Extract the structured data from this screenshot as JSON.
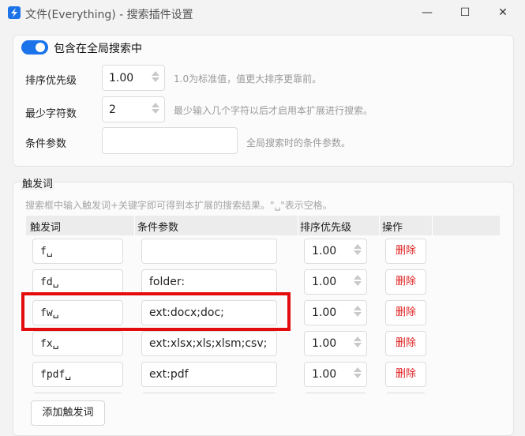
{
  "window": {
    "title": "文件(Everything) - 搜索插件设置",
    "minimize": "—",
    "maximize": "☐",
    "close": "✕",
    "app_icon": "app-logo-icon"
  },
  "settings": {
    "include_global_label": "包含在全局搜索中",
    "include_global_on": true,
    "priority": {
      "label": "排序优先级",
      "value": "1.00",
      "hint": "1.0为标准值，值更大排序更靠前。"
    },
    "min_chars": {
      "label": "最少字符数",
      "value": "2",
      "hint": "最少输入几个字符以后才启用本扩展进行搜索。"
    },
    "condition": {
      "label": "条件参数",
      "value": "",
      "hint": "全局搜索时的条件参数。"
    }
  },
  "triggers": {
    "section_title": "触发词",
    "hint": "搜索框中输入触发词+关键字即可得到本扩展的搜索结果。\"␣\"表示空格。",
    "columns": {
      "trigger": "触发词",
      "condition": "条件参数",
      "priority": "排序优先级",
      "actions": "操作"
    },
    "rows": [
      {
        "trigger": "f␣",
        "condition": "",
        "priority": "1.00",
        "delete_label": "删除"
      },
      {
        "trigger": "fd␣",
        "condition": "folder:",
        "priority": "1.00",
        "delete_label": "删除"
      },
      {
        "trigger": "fw␣",
        "condition": "ext:docx;doc;",
        "priority": "1.00",
        "delete_label": "删除"
      },
      {
        "trigger": "fx␣",
        "condition": "ext:xlsx;xls;xlsm;csv;",
        "priority": "1.00",
        "delete_label": "删除"
      },
      {
        "trigger": "fpdf␣",
        "condition": "ext:pdf",
        "priority": "1.00",
        "delete_label": "删除"
      }
    ],
    "add_button": "添加触发词"
  },
  "colors": {
    "accent": "#1a73e8",
    "danger": "#e02020",
    "highlight": "#e30b0b"
  }
}
